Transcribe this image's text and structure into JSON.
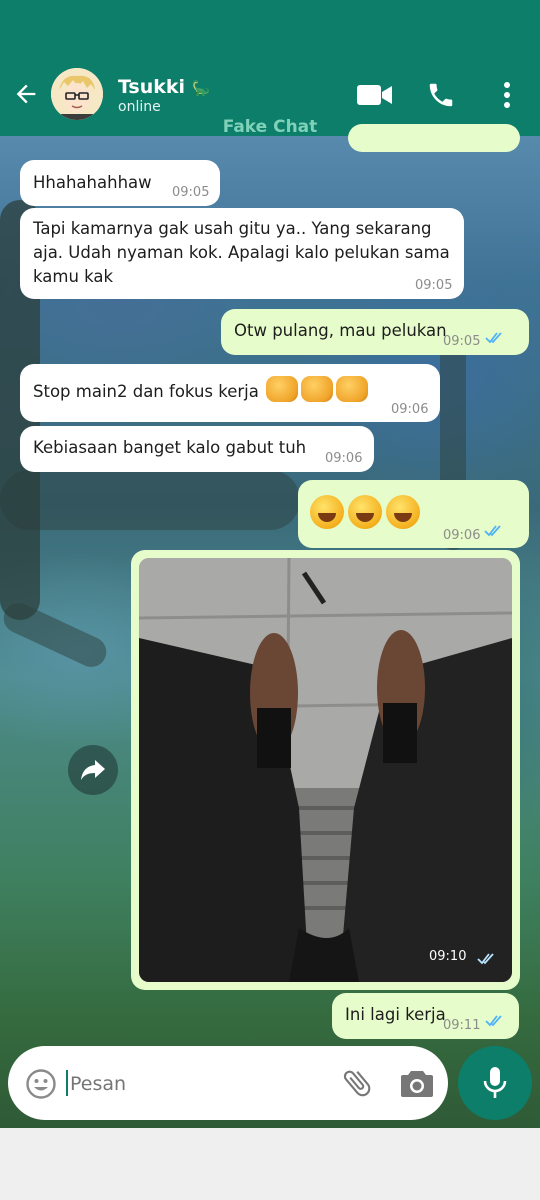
{
  "header": {
    "contact_name": "Tsukki",
    "name_suffix_emoji": "🦕",
    "status": "online",
    "watermark": "Fake Chat",
    "icons": [
      "back-arrow-icon",
      "video-call-icon",
      "phone-icon",
      "more-vert-icon"
    ]
  },
  "messages": [
    {
      "dir": "in",
      "text": "Hhahahahhaw",
      "time": "09:05"
    },
    {
      "dir": "in",
      "text": "Tapi kamarnya gak usah gitu ya.. Yang sekarang aja. Udah nyaman kok. Apalagi kalo pelukan sama kamu kak",
      "time": "09:05"
    },
    {
      "dir": "out",
      "text": "Otw pulang, mau pelukan",
      "time": "09:05",
      "status": "read"
    },
    {
      "dir": "in",
      "text": "Stop main2 dan fokus kerja",
      "emoji": "👊👊👊",
      "time": "09:06"
    },
    {
      "dir": "in",
      "text": "Kebiasaan banget kalo gabut tuh",
      "time": "09:06"
    },
    {
      "dir": "out",
      "emoji": "🤣🤣🤣",
      "time": "09:06",
      "status": "read"
    },
    {
      "dir": "out",
      "type": "image",
      "time": "09:10",
      "status": "read"
    },
    {
      "dir": "out",
      "text": "Ini lagi kerja",
      "time": "09:11",
      "status": "read"
    }
  ],
  "composer": {
    "placeholder": "Pesan",
    "icons": [
      "emoji-icon",
      "attach-icon",
      "camera-icon",
      "mic-icon"
    ]
  },
  "colors": {
    "header": "#0c7e6a",
    "bubble_out": "#e7fccb",
    "bubble_in": "#ffffff",
    "tick_read": "#4fb3f6"
  }
}
